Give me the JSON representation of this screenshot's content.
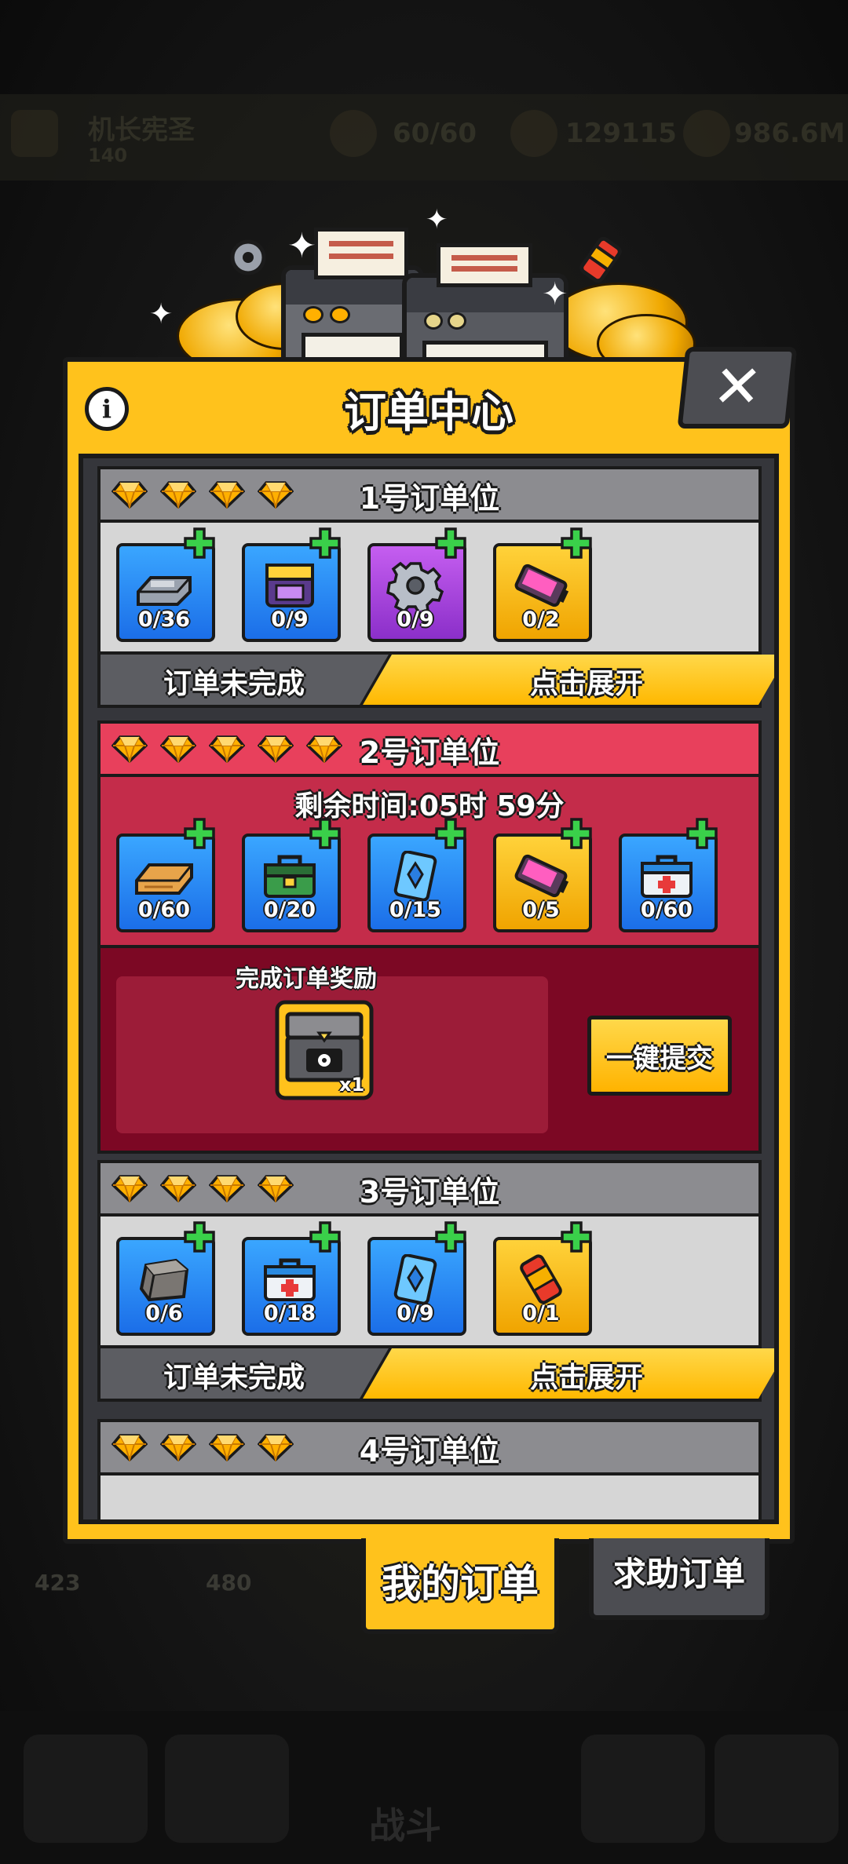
{
  "background": {
    "player_name": "机长宪圣",
    "player_level": "140",
    "energy": "60/60",
    "gems": "129115",
    "gold": "986.6M",
    "side_counts": [
      "423",
      "480"
    ],
    "fight_label": "战斗"
  },
  "panel": {
    "title": "订单中心",
    "info_label": "i",
    "close_label": "✕"
  },
  "slots": [
    {
      "title": "1号订单位",
      "gems": 4,
      "status": "订单未完成",
      "expand_label": "点击展开",
      "items": [
        {
          "icon": "metal-ingot-icon",
          "count": "0/36",
          "frame": "blue"
        },
        {
          "icon": "circuit-chip-icon",
          "count": "0/9",
          "frame": "blue"
        },
        {
          "icon": "gear-icon",
          "count": "0/9",
          "frame": "purple"
        },
        {
          "icon": "battery-icon",
          "count": "0/2",
          "frame": "gold"
        }
      ]
    },
    {
      "title": "2号订单位",
      "gems": 5,
      "timer": "剩余时间:05时 59分",
      "reward_label": "完成订单奖励",
      "reward_count": "x1",
      "submit_label": "一键提交",
      "items": [
        {
          "icon": "wood-plank-icon",
          "count": "0/60",
          "frame": "blue"
        },
        {
          "icon": "toolbox-icon",
          "count": "0/20",
          "frame": "blue"
        },
        {
          "icon": "crystal-card-icon",
          "count": "0/15",
          "frame": "blue"
        },
        {
          "icon": "battery-icon",
          "count": "0/5",
          "frame": "gold"
        },
        {
          "icon": "medkit-icon",
          "count": "0/60",
          "frame": "blue"
        }
      ]
    },
    {
      "title": "3号订单位",
      "gems": 4,
      "status": "订单未完成",
      "expand_label": "点击展开",
      "items": [
        {
          "icon": "stone-block-icon",
          "count": "0/6",
          "frame": "blue"
        },
        {
          "icon": "medkit-icon",
          "count": "0/18",
          "frame": "blue"
        },
        {
          "icon": "crystal-card-icon",
          "count": "0/9",
          "frame": "blue"
        },
        {
          "icon": "canister-icon",
          "count": "0/1",
          "frame": "gold"
        }
      ]
    },
    {
      "title": "4号订单位",
      "gems": 4
    }
  ],
  "tabs": {
    "my_orders": "我的订单",
    "help_orders": "求助订单"
  },
  "colors": {
    "panel_yellow": "#ffc21c",
    "slot_grey": "#8c8c90",
    "active_red": "#e8405c",
    "reward_dark": "#7c0824"
  }
}
